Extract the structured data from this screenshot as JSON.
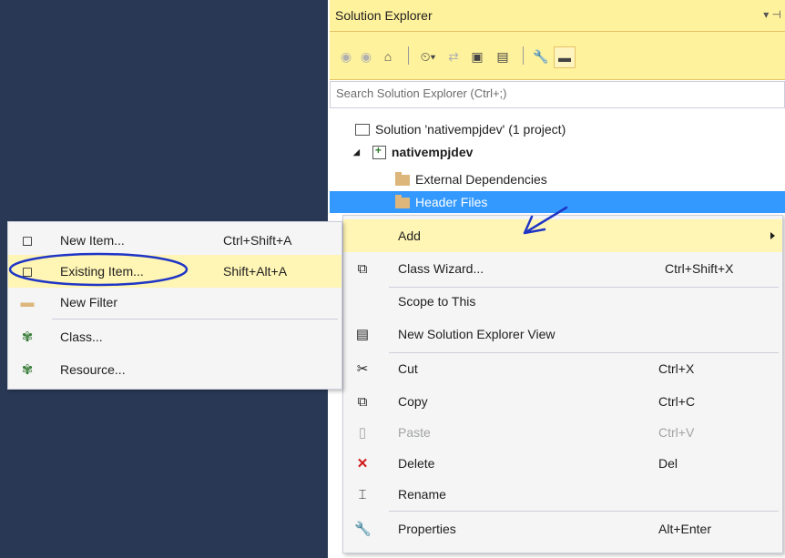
{
  "panel": {
    "title": "Solution Explorer",
    "pin": "▾ ⊣",
    "search_placeholder": "Search Solution Explorer (Ctrl+;)"
  },
  "toolbar_icons": [
    "back-icon",
    "forward-icon",
    "home-icon",
    "history-icon",
    "sync-icon",
    "collapse-all-icon",
    "show-all-files-icon",
    "properties-icon",
    "pin-active-icon"
  ],
  "tree": {
    "solution": "Solution 'nativempjdev' (1 project)",
    "project": "nativempjdev",
    "items": [
      "External Dependencies",
      "Header Files"
    ]
  },
  "context_menu": [
    {
      "label": "Add",
      "shortcut": "",
      "icon": "",
      "submenu": true,
      "highlighted": true
    },
    {
      "label": "Class Wizard...",
      "shortcut": "Ctrl+Shift+X",
      "icon": "class-wizard-icon"
    },
    {
      "label": "Scope to This",
      "shortcut": "",
      "icon": ""
    },
    {
      "label": "New Solution Explorer View",
      "shortcut": "",
      "icon": "new-view-icon"
    },
    {
      "label": "Cut",
      "shortcut": "Ctrl+X",
      "icon": "scissors-icon"
    },
    {
      "label": "Copy",
      "shortcut": "Ctrl+C",
      "icon": "copy-icon"
    },
    {
      "label": "Paste",
      "shortcut": "Ctrl+V",
      "icon": "paste-icon",
      "disabled": true
    },
    {
      "label": "Delete",
      "shortcut": "Del",
      "icon": "delete-icon"
    },
    {
      "label": "Rename",
      "shortcut": "",
      "icon": "rename-icon"
    },
    {
      "label": "Properties",
      "shortcut": "Alt+Enter",
      "icon": "wrench-icon"
    }
  ],
  "submenu": [
    {
      "label": "New Item...",
      "shortcut": "Ctrl+Shift+A",
      "icon": "new-item-icon"
    },
    {
      "label": "Existing Item...",
      "shortcut": "Shift+Alt+A",
      "icon": "existing-item-icon",
      "highlighted": true
    },
    {
      "label": "New Filter",
      "shortcut": "",
      "icon": "folder-icon"
    },
    {
      "label": "Class...",
      "shortcut": "",
      "icon": "class-icon"
    },
    {
      "label": "Resource...",
      "shortcut": "",
      "icon": "resource-icon"
    }
  ],
  "colors": {
    "toolbar": "#fff29d",
    "selection": "#3399ff",
    "menu_highlight": "#fff5b5",
    "annotation": "#1f35c6",
    "background": "#293955"
  }
}
